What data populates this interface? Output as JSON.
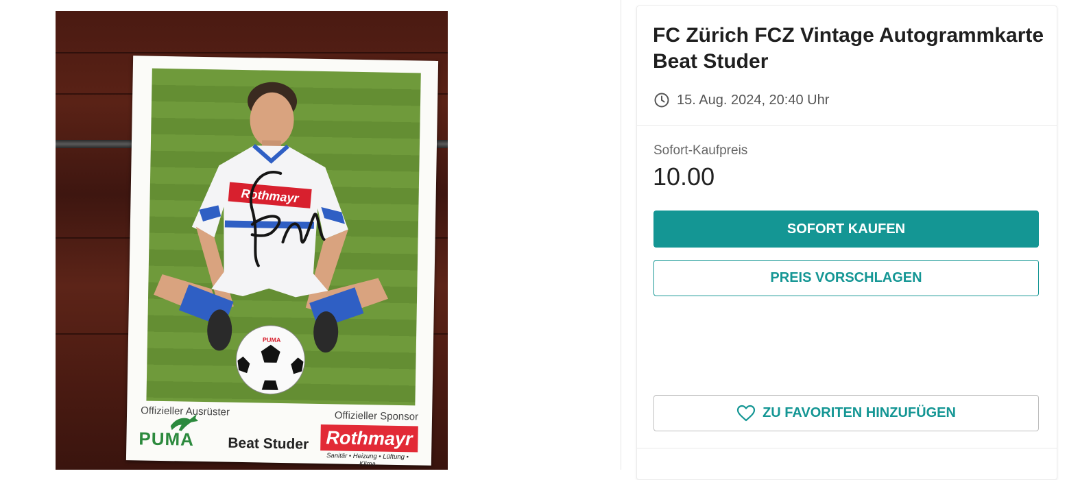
{
  "listing": {
    "title": "FC Zürich FCZ Vintage Autogrammkarte Beat Studer",
    "date": "15. Aug. 2024, 20:40 Uhr",
    "price_label": "Sofort-Kaufpreis",
    "price_value": "10.00",
    "buy_now_label": "SOFORT KAUFEN",
    "make_offer_label": "PREIS VORSCHLAGEN",
    "favorite_label": "ZU FAVORITEN HINZUFÜGEN"
  },
  "photo": {
    "card_left_label": "Offizieller Ausrüster",
    "card_right_label": "Offizieller Sponsor",
    "outfitter_logo": "PUMA",
    "player_name": "Beat Studer",
    "sponsor_logo": "Rothmayr",
    "sponsor_tagline": "Sanitär • Heizung • Lüftung • Klima",
    "shirt_sponsor": "Rothmayr",
    "ball_text": "PUMA"
  },
  "icons": {
    "clock": "clock-icon",
    "heart": "heart-icon"
  },
  "colors": {
    "accent": "#149694",
    "sponsor_red": "#e22a36",
    "puma_green": "#2c8a3e"
  }
}
